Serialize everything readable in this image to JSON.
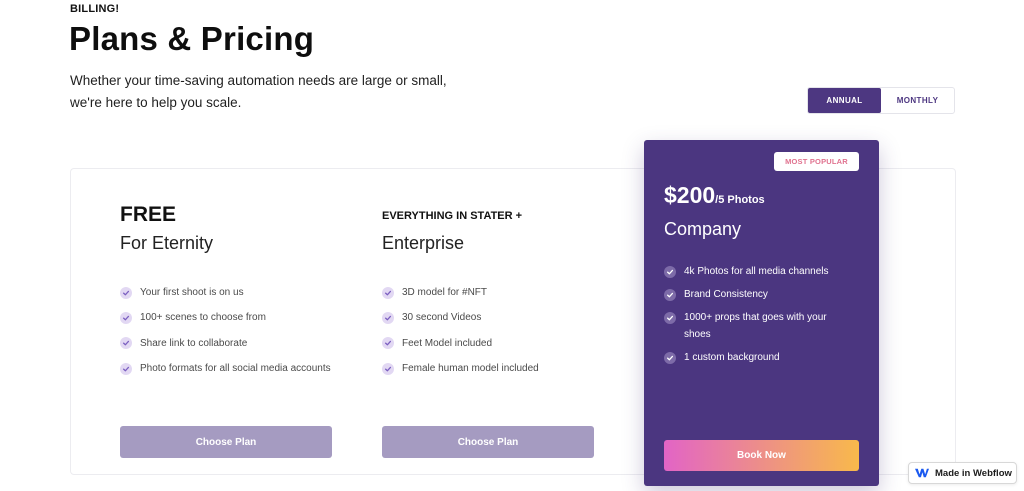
{
  "header": {
    "eyebrow": "BILLING!",
    "title": "Plans & Pricing",
    "subtitle_line1": "Whether your time-saving automation needs are large or small,",
    "subtitle_line2": "we're here to help you scale."
  },
  "billing_toggle": {
    "options": [
      "ANNUAL",
      "MONTHLY"
    ],
    "selected": "ANNUAL"
  },
  "plans": [
    {
      "name": "FREE",
      "tagline": "For Eternity",
      "features": [
        "Your first shoot is on us",
        "100+ scenes to choose from",
        "Share link to collaborate",
        "Photo formats for all social media accounts"
      ],
      "cta": "Choose Plan"
    },
    {
      "name": "EVERYTHING IN STATER +",
      "tagline": "Enterprise",
      "features": [
        "3D model for #NFT",
        "30 second Videos",
        "Feet Model included",
        "Female human model included"
      ],
      "cta": "Choose Plan"
    }
  ],
  "featured_plan": {
    "badge": "MOST POPULAR",
    "price": "$200",
    "price_unit": "/5 Photos",
    "name": "Company",
    "features": [
      "4k Photos for all media channels",
      "Brand Consistency",
      "1000+ props that goes with your shoes",
      "1 custom background"
    ],
    "cta": "Book Now"
  },
  "footer_badge": {
    "label": "Made in Webflow",
    "icon": "webflow-icon"
  },
  "colors": {
    "brand_purple": "#4b3680",
    "muted_button": "#a59bc1",
    "check_bg": "#e2d8f3",
    "cta_gradient_start": "#e264c6",
    "cta_gradient_end": "#f8b94b",
    "badge_text": "#e0728f"
  },
  "icons": {
    "check": "check-icon"
  }
}
